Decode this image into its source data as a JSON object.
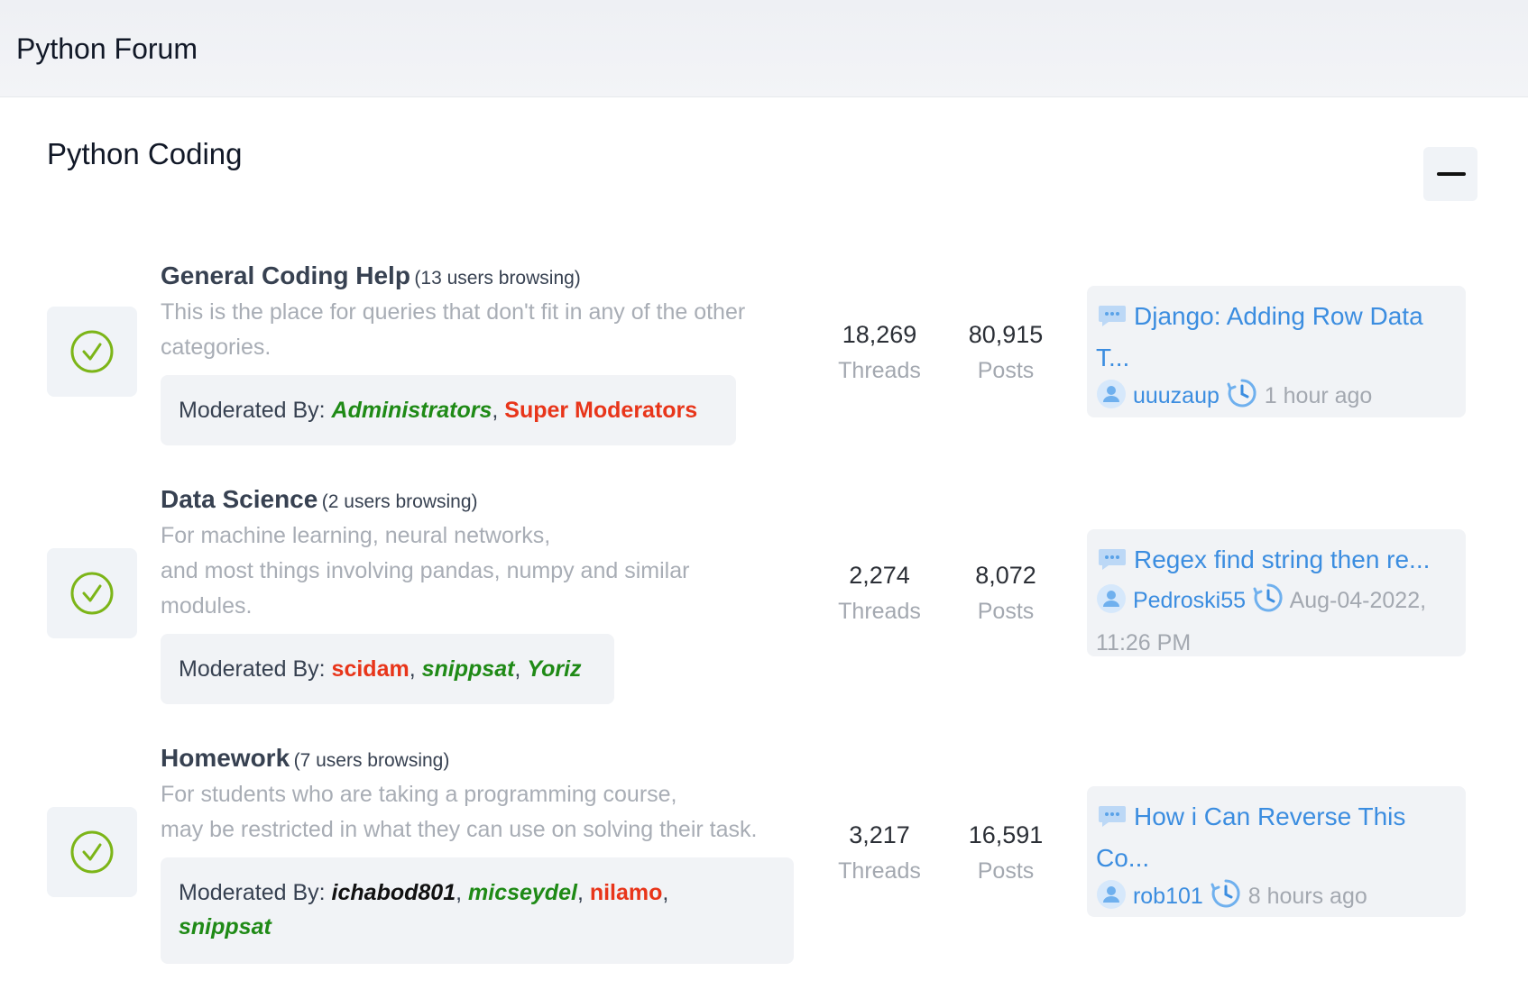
{
  "header": {
    "title": "Python Forum"
  },
  "category": {
    "title": "Python Coding"
  },
  "forums": [
    {
      "name": "General Coding Help",
      "browsing": "(13 users browsing)",
      "description": "This is the place for queries that don't fit in any of the other categories.",
      "moderated_label": "Moderated By:",
      "moderators": [
        {
          "name": "Administrators",
          "style": "green"
        },
        {
          "name": "Super Moderators",
          "style": "red"
        }
      ],
      "threads": "18,269",
      "threads_label": "Threads",
      "posts": "80,915",
      "posts_label": "Posts",
      "last_post": {
        "title": "Django: Adding Row Data T...",
        "user": "uuuzaup",
        "time": "1 hour ago"
      }
    },
    {
      "name": "Data Science",
      "browsing": "(2 users browsing)",
      "description_lines": [
        "For machine learning, neural networks,",
        "and most things involving pandas, numpy and similar modules."
      ],
      "moderated_label": "Moderated By:",
      "moderators": [
        {
          "name": "scidam",
          "style": "red"
        },
        {
          "name": "snippsat",
          "style": "green"
        },
        {
          "name": "Yoriz",
          "style": "green"
        }
      ],
      "threads": "2,274",
      "threads_label": "Threads",
      "posts": "8,072",
      "posts_label": "Posts",
      "last_post": {
        "title": "Regex find string then re...",
        "user": "Pedroski55",
        "time": "Aug-04-2022, 11:26 PM"
      }
    },
    {
      "name": "Homework",
      "browsing": "(7 users browsing)",
      "description_lines": [
        "For students who are taking a programming course,",
        "may be restricted in what they can use on solving their task."
      ],
      "moderated_label": "Moderated By:",
      "moderators": [
        {
          "name": "ichabod801",
          "style": "black"
        },
        {
          "name": "micseydel",
          "style": "green"
        },
        {
          "name": "nilamo",
          "style": "red"
        },
        {
          "name": "snippsat",
          "style": "green"
        }
      ],
      "threads": "3,217",
      "threads_label": "Threads",
      "posts": "16,591",
      "posts_label": "Posts",
      "last_post": {
        "title": "How i Can Reverse This Co...",
        "user": "rob101",
        "time": "8 hours ago"
      }
    }
  ],
  "colors": {
    "accent_link": "#3b8de0",
    "mod_green": "#1f8a16",
    "mod_red": "#e8351a",
    "status_green": "#7cb518"
  },
  "icons": {
    "status": "check-circle-icon",
    "collapse": "minus-icon",
    "last_post": "chat-bubble-icon",
    "user": "user-avatar-icon",
    "time": "clock-history-icon"
  }
}
